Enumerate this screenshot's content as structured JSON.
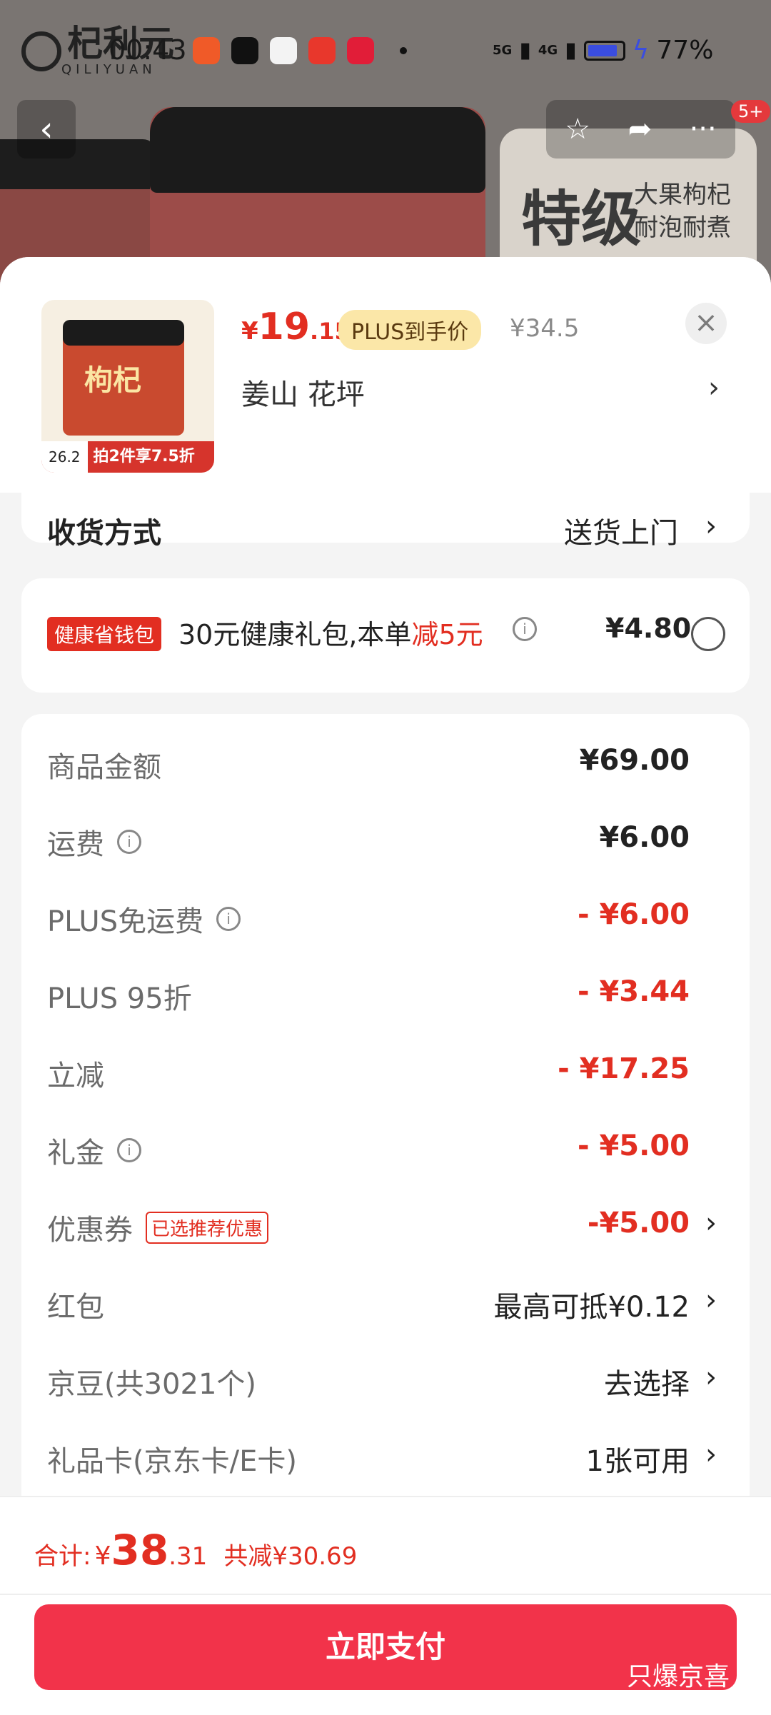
{
  "status_bar": {
    "time": "00:43",
    "network": [
      "5G",
      "4G"
    ],
    "battery_percent": "77%",
    "battery_level": 0.77,
    "accent": "#3a4de0"
  },
  "background_page": {
    "brand_name": "杞利元",
    "brand_sub": "QILIYUAN",
    "banner_big": "特级",
    "banner_line1": "大果枸杞",
    "banner_line2": "耐泡耐煮",
    "cart_badge": "5+"
  },
  "product": {
    "thumbnail_title": "枸杞",
    "thumbnail_price": "26.2",
    "thumbnail_promo": "拍2件享7.5折",
    "price_symbol": "¥",
    "price_int": "19",
    "price_dec": ".15",
    "plus_tag": "PLUS到手价",
    "original_price": "¥34.5",
    "spec": "姜山  花坪",
    "accent_red": "#e22e21"
  },
  "delivery": {
    "label": "收货方式",
    "value": "送货上门"
  },
  "health_pack": {
    "tag": "健康省钱包",
    "text_prefix": "30元健康礼包,本单",
    "text_highlight": "减5元",
    "price": "¥4.80",
    "selected": false
  },
  "price_details": [
    {
      "label": "商品金额",
      "value": "¥69.00",
      "info": false,
      "style": "bold",
      "arrow": false
    },
    {
      "label": "运费",
      "value": "¥6.00",
      "info": true,
      "style": "bold",
      "arrow": false
    },
    {
      "label": "PLUS免运费",
      "value": "- ¥6.00",
      "info": true,
      "style": "red",
      "arrow": false
    },
    {
      "label": "PLUS 95折",
      "value": "- ¥3.44",
      "info": false,
      "style": "red",
      "arrow": false
    },
    {
      "label": "立减",
      "value": "- ¥17.25",
      "info": false,
      "style": "red",
      "arrow": false
    },
    {
      "label": "礼金",
      "value": "- ¥5.00",
      "info": true,
      "style": "red",
      "arrow": false
    },
    {
      "label": "优惠券",
      "value": "-¥5.00",
      "info": false,
      "style": "red",
      "arrow": true,
      "tag": "已选推荐优惠"
    },
    {
      "label": "红包",
      "value": "最高可抵¥0.12",
      "info": false,
      "style": "plain",
      "arrow": true
    },
    {
      "label": "京豆(共3021个)",
      "value": "去选择",
      "info": false,
      "style": "plain",
      "arrow": true
    },
    {
      "label": "礼品卡(京东卡/E卡)",
      "value": "1张可用",
      "info": false,
      "style": "plain",
      "arrow": true
    }
  ],
  "bottom": {
    "total_label": "合计:",
    "total_symbol": "¥",
    "total_int": "38",
    "total_dec": ".31",
    "saved": "共减¥30.69",
    "pay_button": "立即支付",
    "button_color": "#f2334a",
    "watermark": "只爆京喜"
  }
}
